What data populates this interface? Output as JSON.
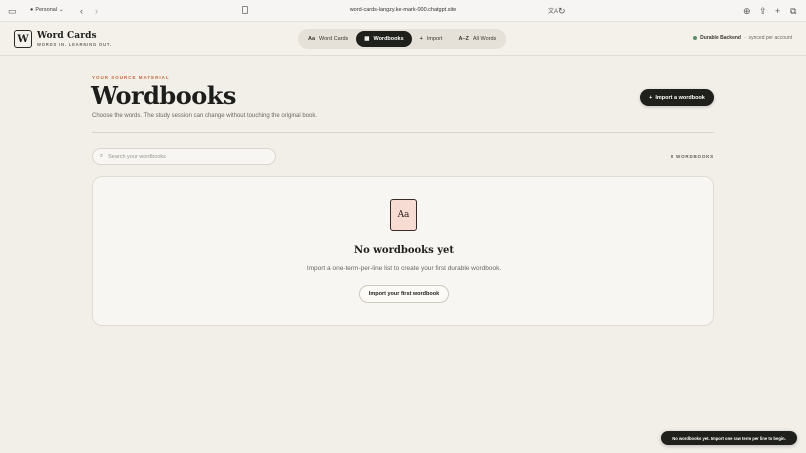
{
  "browser": {
    "profile": "Personal",
    "url": "word-cards-langzy.ke-mark-000.chatgpt.site"
  },
  "brand": {
    "logo_letter": "W",
    "name": "Word Cards",
    "tagline": "WORDS IN. LEARNING OUT."
  },
  "nav": {
    "tabs": [
      {
        "icon": "Aa",
        "label": "Word Cards"
      },
      {
        "icon": "▦",
        "label": "Wordbooks"
      },
      {
        "icon": "+",
        "label": "Import"
      },
      {
        "icon": "A–Z",
        "label": "All Words"
      }
    ],
    "active": "Wordbooks"
  },
  "status": {
    "label": "Durable Backend",
    "separator": "·",
    "detail": "synced per account",
    "color": "#5c8f6a"
  },
  "main": {
    "eyebrow": "YOUR SOURCE MATERIAL",
    "title": "Wordbooks",
    "subtitle": "Choose the words. The study session can change without touching the original book.",
    "import_button": "Import a wordbook",
    "import_icon": "+",
    "search_placeholder": "Search your wordbooks",
    "count": "0 WORDBOOKS"
  },
  "empty": {
    "icon_text": "Aa",
    "title": "No wordbooks yet",
    "description": "Import a one-term-per-line list to create your first durable wordbook.",
    "button": "Import your first wordbook"
  },
  "toast": {
    "message": "No wordbooks yet. Import one raw term per line to begin."
  },
  "colors": {
    "accent": "#c06a3e",
    "dark": "#1f201c",
    "background": "#f2efe9"
  }
}
